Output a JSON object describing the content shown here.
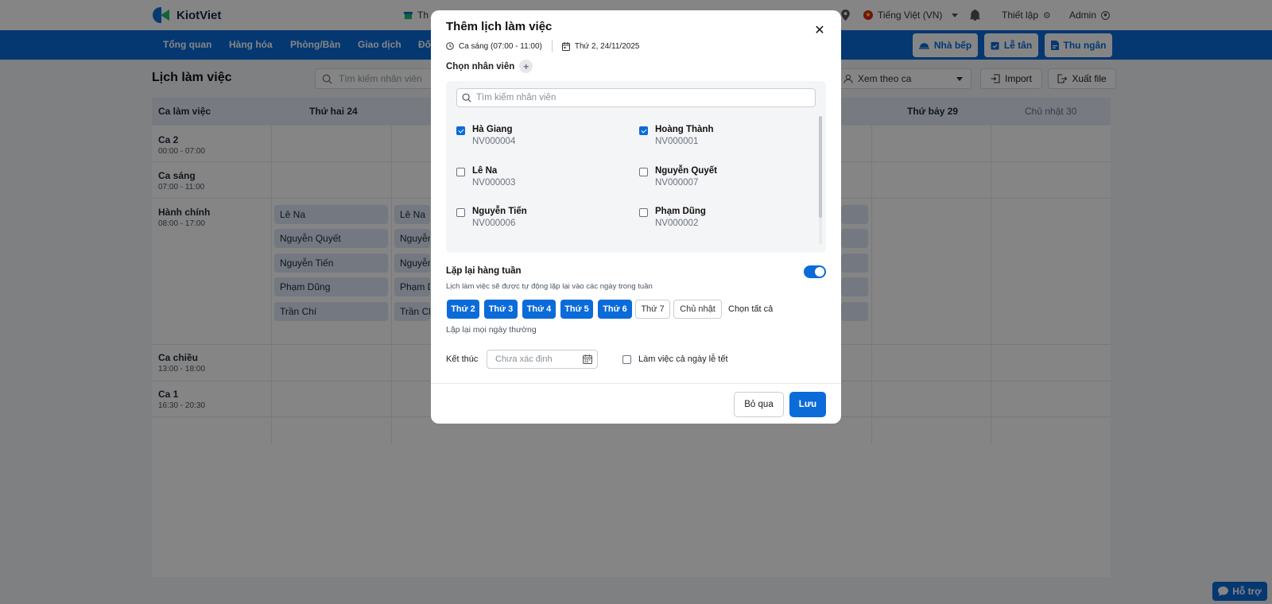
{
  "app": {
    "logo_text": "KiotViet",
    "partial_tab": "Th"
  },
  "topbar": {
    "language": "Tiếng Việt (VN)",
    "settings": "Thiết lập",
    "user": "Admin"
  },
  "nav": {
    "items": [
      "Tổng quan",
      "Hàng hóa",
      "Phòng/Bàn",
      "Giao dịch",
      "Đối"
    ],
    "actions": {
      "kitchen": "Nhà bếp",
      "reception": "Lễ tân",
      "cashier": "Thu ngân"
    }
  },
  "page": {
    "title": "Lịch làm việc",
    "search_placeholder": "Tìm kiếm nhân viên",
    "view_by": "Xem theo ca",
    "import_label": "Import",
    "export_label": "Xuất file"
  },
  "grid": {
    "shift_col_header": "Ca làm việc",
    "day_headers": [
      "Thứ hai 24",
      "Thứ bảy 29",
      "Chủ nhật 30"
    ],
    "shifts": [
      {
        "name": "Ca 2",
        "time": "00:00 - 07:00"
      },
      {
        "name": "Ca sáng",
        "time": "07:00 - 11:00"
      },
      {
        "name": "Hành chính",
        "time": "08:00 - 17:00"
      },
      {
        "name": "Ca chiều",
        "time": "13:00 - 18:00"
      },
      {
        "name": "Ca 1",
        "time": "16:30 - 20:30"
      }
    ],
    "monday_staff": [
      "Lê Na",
      "Nguyễn Quyết",
      "Nguyễn Tiến",
      "Phạm Dũng",
      "Trần Chí"
    ],
    "tuesday_staff_partial": [
      "Lê Na",
      "Nguyễn",
      "Nguyễn",
      "Phạm D",
      "Trần Ch"
    ]
  },
  "modal": {
    "title": "Thêm lịch làm việc",
    "shift_info": "Ca sáng (07:00 - 11:00)",
    "date_info": "Thứ 2, 24/11/2025",
    "choose_staff_label": "Chọn nhân viên",
    "staff_search_placeholder": "Tìm kiếm nhân viên",
    "staff": [
      {
        "name": "Hà Giang",
        "code": "NV000004",
        "checked": true
      },
      {
        "name": "Hoàng Thành",
        "code": "NV000001",
        "checked": true
      },
      {
        "name": "Lê Na",
        "code": "NV000003",
        "checked": false
      },
      {
        "name": "Nguyễn Quyết",
        "code": "NV000007",
        "checked": false
      },
      {
        "name": "Nguyễn Tiến",
        "code": "NV000006",
        "checked": false
      },
      {
        "name": "Phạm Dũng",
        "code": "NV000002",
        "checked": false
      }
    ],
    "repeat_label": "Lặp lại hàng tuần",
    "repeat_enabled": true,
    "repeat_desc": "Lịch làm việc sẽ được tự động lặp lại vào các ngày trong tuần",
    "days": [
      {
        "label": "Thứ 2",
        "on": true
      },
      {
        "label": "Thứ 3",
        "on": true
      },
      {
        "label": "Thứ 4",
        "on": true
      },
      {
        "label": "Thứ 5",
        "on": true
      },
      {
        "label": "Thứ 6",
        "on": true
      },
      {
        "label": "Thứ 7",
        "on": false
      },
      {
        "label": "Chủ nhật",
        "on": false
      }
    ],
    "select_all": "Chọn tất cả",
    "repeat_summary": "Lặp lại mọi ngày thường",
    "end_label": "Kết thúc",
    "end_placeholder": "Chưa xác định",
    "holiday_label": "Làm việc cả ngày lễ tết",
    "cancel_label": "Bỏ qua",
    "save_label": "Lưu"
  },
  "help": {
    "label": "Hỗ trợ"
  },
  "colors": {
    "primary": "#0b6bd9",
    "chip": "#dce7f7",
    "grid_header": "#e4ecf8"
  }
}
